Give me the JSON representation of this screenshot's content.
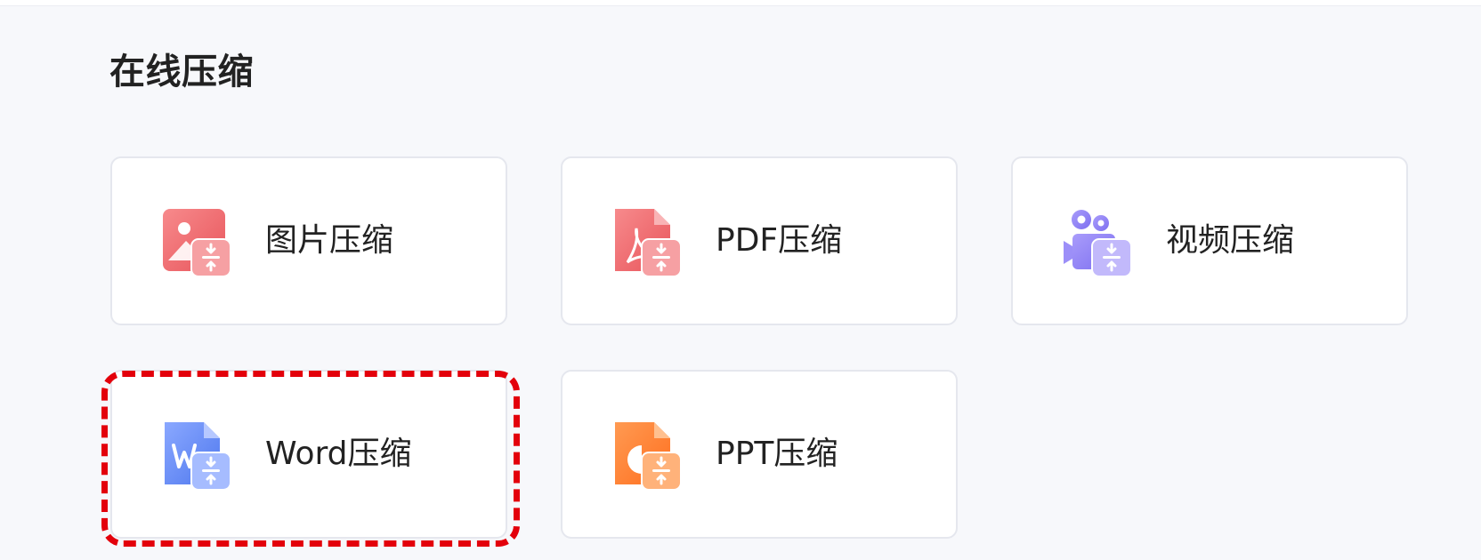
{
  "section": {
    "title": "在线压缩"
  },
  "cards": [
    {
      "label": "图片压缩",
      "icon": "image-compress-icon",
      "color": "#ef6a6e"
    },
    {
      "label": "PDF压缩",
      "icon": "pdf-compress-icon",
      "color": "#ef6a6e"
    },
    {
      "label": "视频压缩",
      "icon": "video-compress-icon",
      "color": "#8b7ef5"
    },
    {
      "label": "Word压缩",
      "icon": "word-compress-icon",
      "color": "#5f8cf5"
    },
    {
      "label": "PPT压缩",
      "icon": "ppt-compress-icon",
      "color": "#ff7a2e"
    }
  ],
  "highlight": {
    "target": "Word压缩",
    "color": "#e3000b"
  }
}
